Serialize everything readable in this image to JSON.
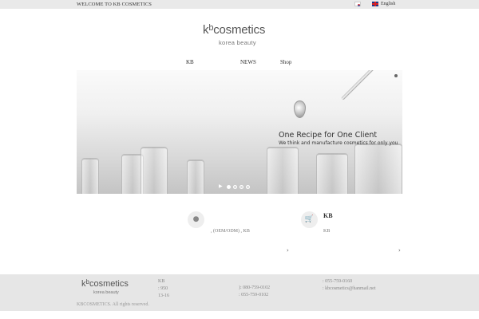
{
  "topbar": {
    "welcome": "WELCOME TO KB COSMETICS",
    "language": "English",
    "flags": [
      "korea-flag-icon",
      "uk-flag-icon"
    ]
  },
  "logo": {
    "brand_prefix": "k",
    "brand_super": "b",
    "brand_rest": "cosmetics",
    "tagline": "korea beauty"
  },
  "nav": {
    "items": [
      "KB",
      "NEWS",
      "Shop"
    ]
  },
  "hero": {
    "title": "One Recipe for One Client",
    "subtitle": "We think and manufacture cosmetics for only you",
    "slide_count": 4,
    "active_slide": 1
  },
  "features": [
    {
      "icon": "user-icon",
      "title": "",
      "text": ", (OEM/ODM) ,    KB",
      "more": "›"
    },
    {
      "icon": "cart-icon",
      "title": "KB",
      "text": "KB",
      "more": "›"
    }
  ],
  "footer": {
    "col1": [
      "KB",
      ": 950",
      "13-16"
    ],
    "col2": [
      "): 080-759-0102",
      ": 055-759-0102"
    ],
    "col3": [
      ": 055-759-0160",
      ": kbcosmetics@hanmail.net"
    ],
    "copyright": "KBCOSMETICS. All rights reserved."
  },
  "colors": {
    "topbar_bg": "#e9e9e9",
    "footer_bg": "#e6e6e6",
    "text": "#333333"
  }
}
